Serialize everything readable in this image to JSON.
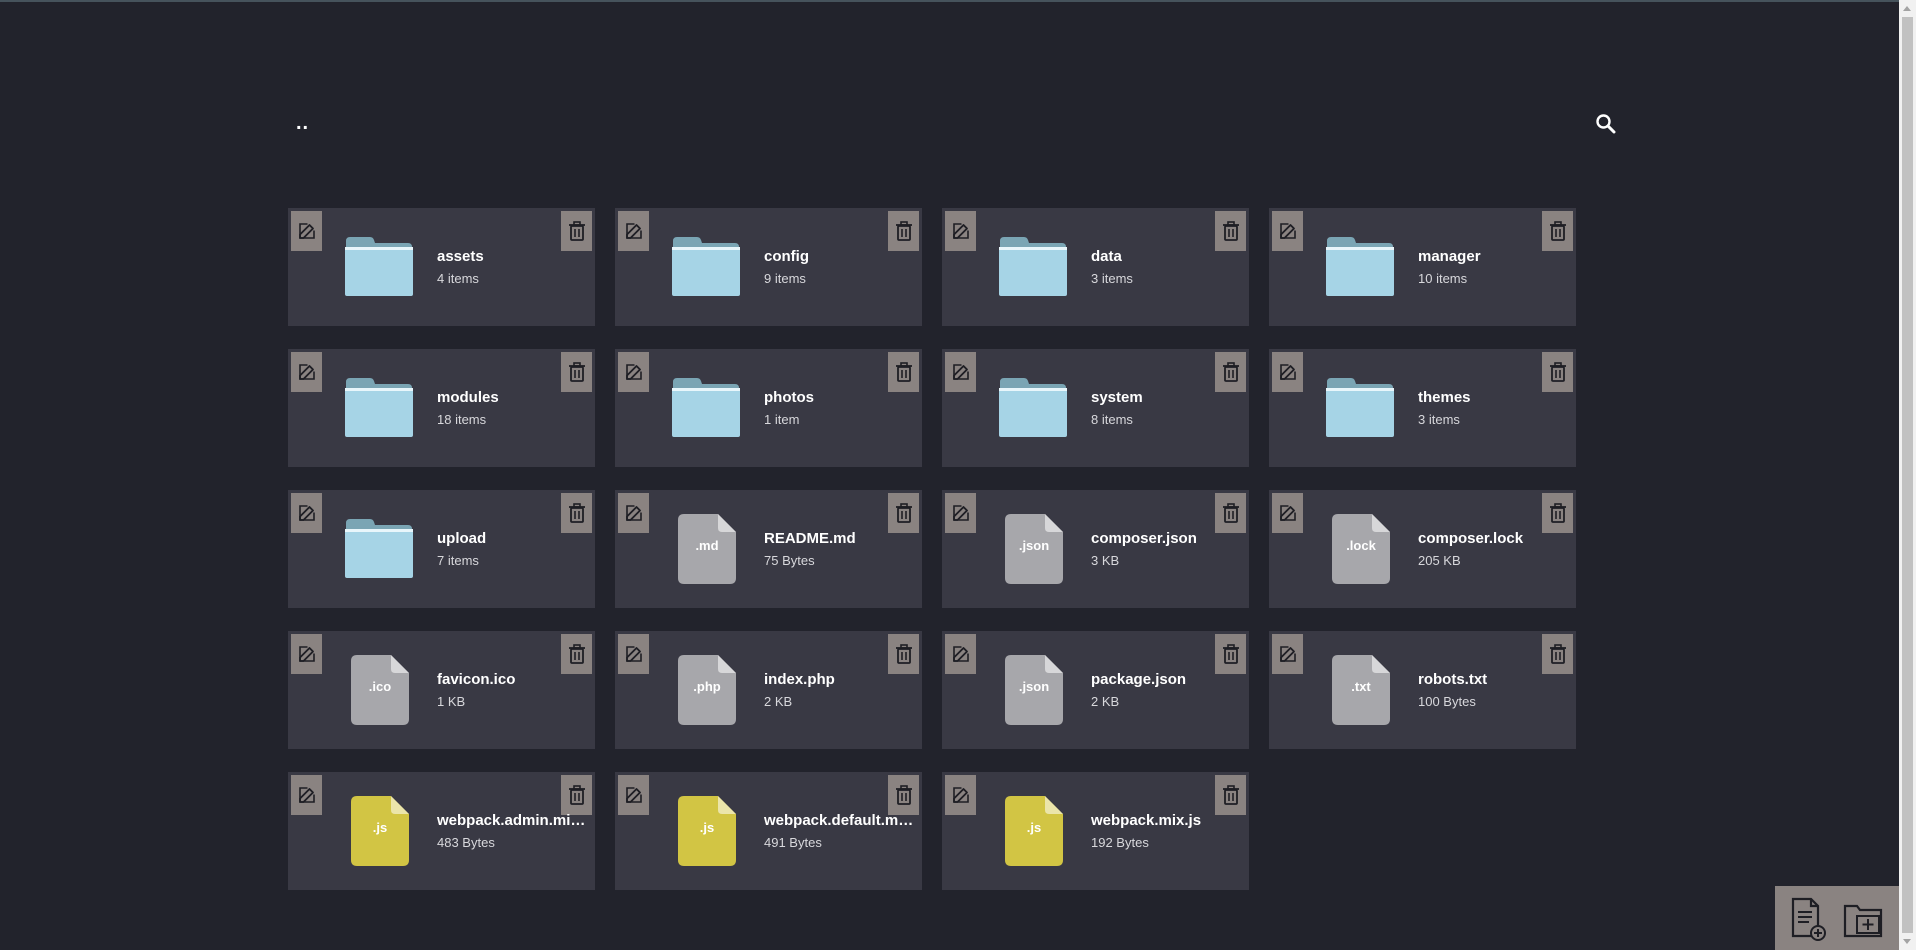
{
  "nav": {
    "up_label": ".."
  },
  "search": {
    "icon": "search-icon"
  },
  "colors": {
    "background": "#22232c",
    "card": "#393944",
    "action_button": "#8a8381",
    "folder": "#a6d4e6",
    "folder_tab": "#7aa5b4",
    "generic_file": "#a7a7ab",
    "js_file": "#d2c544"
  },
  "items": [
    {
      "type": "folder",
      "name": "assets",
      "size": "4 items"
    },
    {
      "type": "folder",
      "name": "config",
      "size": "9 items"
    },
    {
      "type": "folder",
      "name": "data",
      "size": "3 items"
    },
    {
      "type": "folder",
      "name": "manager",
      "size": "10 items"
    },
    {
      "type": "folder",
      "name": "modules",
      "size": "18 items"
    },
    {
      "type": "folder",
      "name": "photos",
      "size": "1 item"
    },
    {
      "type": "folder",
      "name": "system",
      "size": "8 items"
    },
    {
      "type": "folder",
      "name": "themes",
      "size": "3 items"
    },
    {
      "type": "folder",
      "name": "upload",
      "size": "7 items"
    },
    {
      "type": "file",
      "ext": ".md",
      "name": "README.md",
      "size": "75 Bytes"
    },
    {
      "type": "file",
      "ext": ".json",
      "name": "composer.json",
      "size": "3 KB"
    },
    {
      "type": "file",
      "ext": ".lock",
      "name": "composer.lock",
      "size": "205 KB"
    },
    {
      "type": "file",
      "ext": ".ico",
      "name": "favicon.ico",
      "size": "1 KB"
    },
    {
      "type": "file",
      "ext": ".php",
      "name": "index.php",
      "size": "2 KB"
    },
    {
      "type": "file",
      "ext": ".json",
      "name": "package.json",
      "size": "2 KB"
    },
    {
      "type": "file",
      "ext": ".txt",
      "name": "robots.txt",
      "size": "100 Bytes"
    },
    {
      "type": "js",
      "ext": ".js",
      "name": "webpack.admin.mix.js",
      "size": "483 Bytes"
    },
    {
      "type": "js",
      "ext": ".js",
      "name": "webpack.default.mix.js",
      "size": "491 Bytes"
    },
    {
      "type": "js",
      "ext": ".js",
      "name": "webpack.mix.js",
      "size": "192 Bytes"
    }
  ],
  "bottom_actions": [
    {
      "name": "new-file-button",
      "icon": "new-file-icon"
    },
    {
      "name": "new-folder-button",
      "icon": "new-folder-icon"
    }
  ]
}
